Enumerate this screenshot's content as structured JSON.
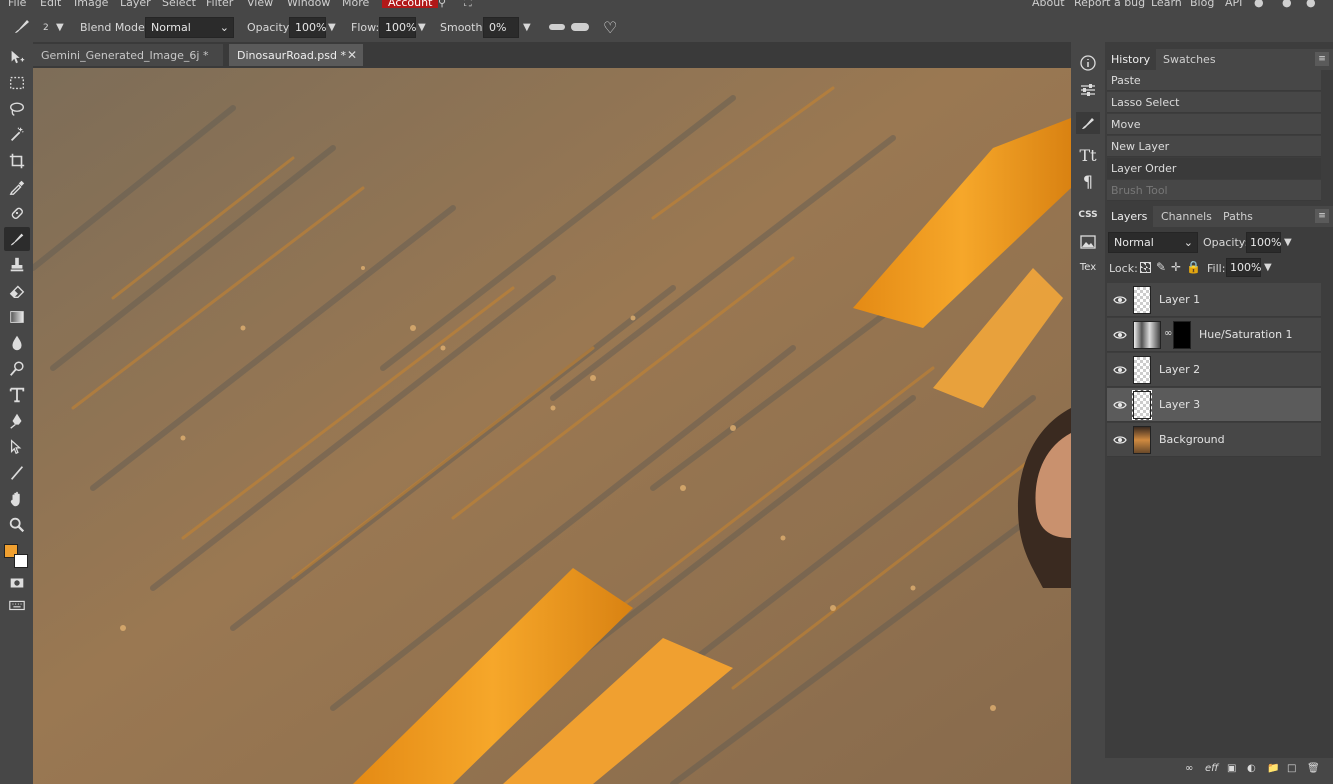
{
  "menubar": {
    "items": [
      "File",
      "Edit",
      "Image",
      "Layer",
      "Select",
      "Filter",
      "View",
      "Window",
      "More"
    ],
    "account": "Account",
    "right": [
      "About",
      "Report a bug",
      "Learn",
      "Blog",
      "API"
    ]
  },
  "options": {
    "brush_size": "2",
    "blend_label": "Blend Mode:",
    "blend_value": "Normal",
    "opacity_label": "Opacity:",
    "opacity_value": "100%",
    "flow_label": "Flow:",
    "flow_value": "100%",
    "smooth_label": "Smooth:",
    "smooth_value": "0%"
  },
  "tabs": [
    {
      "label": "Gemini_Generated_Image_6j *",
      "active": false
    },
    {
      "label": "DinosaurRoad.psd *",
      "active": true
    }
  ],
  "minipanel": {
    "css": "CSS",
    "tex": "Tex"
  },
  "history_panel": {
    "tabs": [
      "History",
      "Swatches"
    ],
    "items": [
      {
        "label": "Paste"
      },
      {
        "label": "Lasso Select"
      },
      {
        "label": "Move"
      },
      {
        "label": "New Layer"
      },
      {
        "label": "Layer Order"
      },
      {
        "label": "Brush Tool"
      }
    ]
  },
  "layers_panel": {
    "tabs": [
      "Layers",
      "Channels",
      "Paths"
    ],
    "blend": "Normal",
    "opacity_label": "Opacity:",
    "opacity_value": "100%",
    "lock_label": "Lock:",
    "fill_label": "Fill:",
    "fill_value": "100%",
    "layers": [
      {
        "name": "Layer 1"
      },
      {
        "name": "Hue/Saturation 1"
      },
      {
        "name": "Layer 2"
      },
      {
        "name": "Layer 3"
      },
      {
        "name": "Background"
      }
    ]
  },
  "bottom_icons": [
    "link-icon",
    "effects-icon",
    "mask-icon",
    "adjustment-icon",
    "folder-icon",
    "new-layer-icon",
    "trash-icon"
  ],
  "colors": {
    "foreground": "#f0a030",
    "background": "#ffffff",
    "accent": "#b01818"
  }
}
